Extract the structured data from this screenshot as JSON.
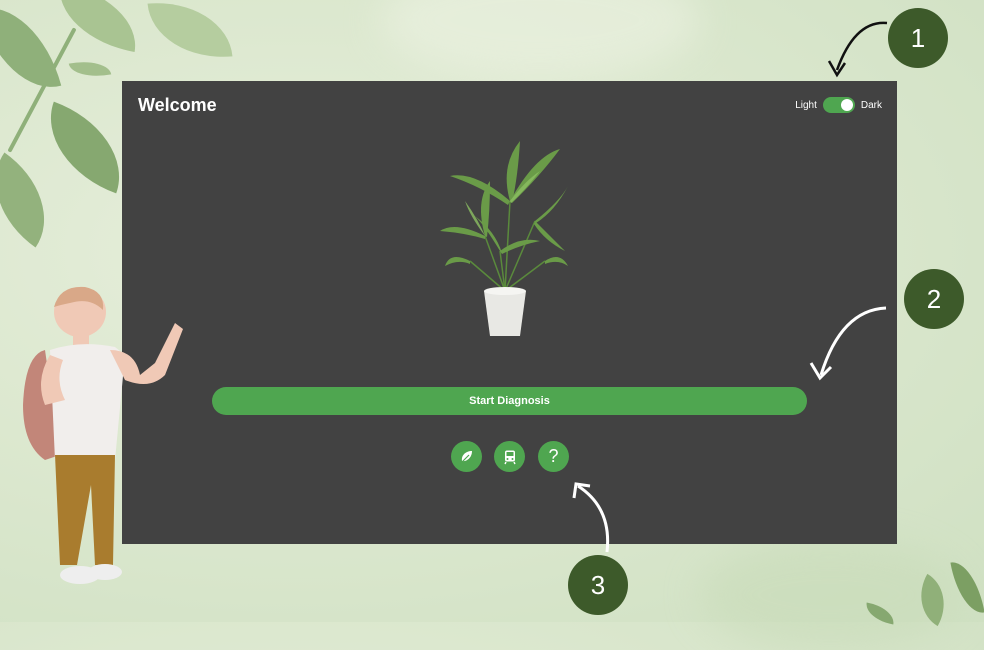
{
  "window": {
    "title": "Welcome"
  },
  "theme_toggle": {
    "light_label": "Light",
    "dark_label": "Dark",
    "state": "dark"
  },
  "main": {
    "start_button_label": "Start Diagnosis"
  },
  "icon_buttons": [
    {
      "name": "leaf-icon"
    },
    {
      "name": "train-icon"
    },
    {
      "name": "question-icon",
      "glyph": "?"
    }
  ],
  "callouts": [
    "1",
    "2",
    "3"
  ],
  "colors": {
    "panel": "#424242",
    "accent": "#4fa650",
    "badge": "#3d5a2a"
  }
}
